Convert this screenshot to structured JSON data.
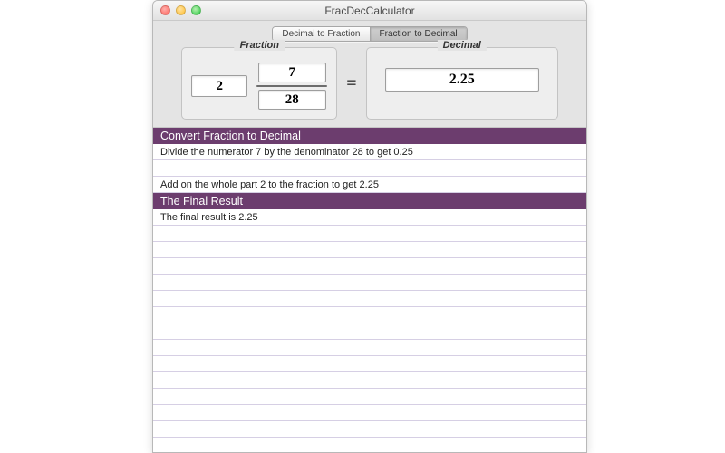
{
  "window": {
    "title": "FracDecCalculator"
  },
  "tabs": {
    "decimal_to_fraction": "Decimal to Fraction",
    "fraction_to_decimal": "Fraction to Decimal"
  },
  "labels": {
    "fraction": "Fraction",
    "decimal": "Decimal",
    "equals": "="
  },
  "inputs": {
    "whole": "2",
    "numerator": "7",
    "denominator": "28",
    "decimal": "2.25"
  },
  "steps": {
    "section1_title": "Convert Fraction to Decimal",
    "line1": "Divide the numerator 7 by the denominator 28 to get 0.25",
    "line2": "Add on the whole part 2 to the fraction to get 2.25",
    "section2_title": "The Final Result",
    "line3": "The final result is 2.25"
  }
}
